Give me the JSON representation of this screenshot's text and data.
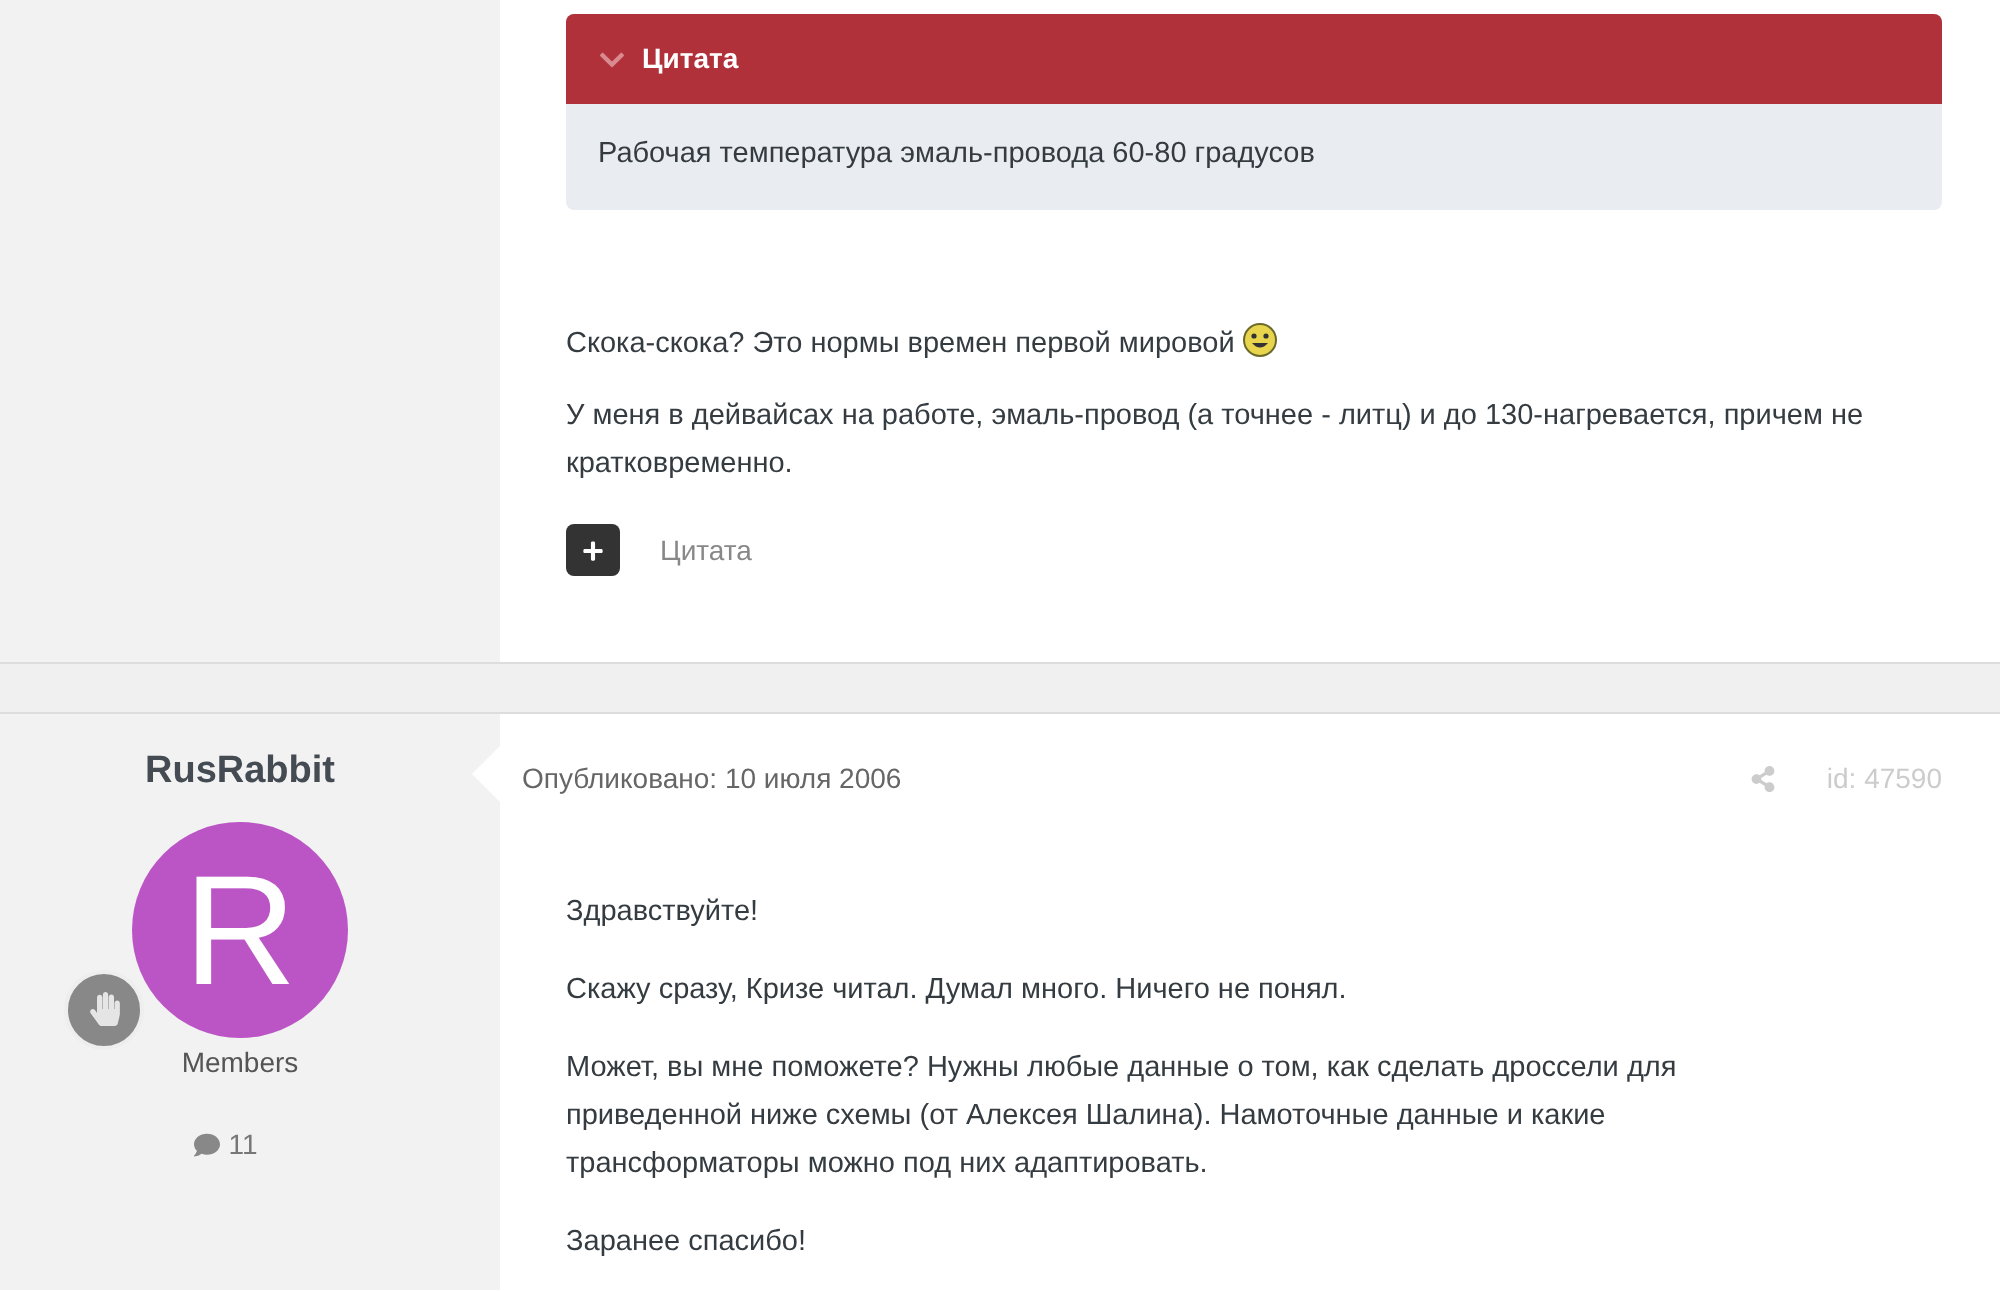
{
  "posts": [
    {
      "quote": {
        "title": "Цитата",
        "text": "Рабочая температура эмаль-провода 60-80 градусов"
      },
      "paragraphs": [
        {
          "text": "Скока-скока? Это нормы времен первой мировой",
          "emoji": true
        },
        {
          "text": "У меня в дейвайсах на работе, эмаль-провод (а точнее - литц) и до 130-нагревается, причем не кратковременно.",
          "emoji": false
        }
      ],
      "quote_button": "Цитата"
    },
    {
      "author": {
        "name": "RusRabbit",
        "initial": "R",
        "group": "Members",
        "posts": "11"
      },
      "published": "Опубликовано: 10 июля 2006",
      "id": "id: 47590",
      "paragraphs": [
        {
          "text": "Здравствуйте!",
          "emoji": false
        },
        {
          "text": "Скажу сразу, Кризе читал. Думал много. Ничего не понял.",
          "emoji": false
        },
        {
          "text": "Может, вы мне поможете? Нужны любые данные о том, как сделать дроссели для приведенной ниже схемы (от Алексея Шалина). Намоточные данные и какие трансформаторы можно под них адаптировать.",
          "emoji": false
        },
        {
          "text": "Заранее спасибо!",
          "emoji": false
        }
      ]
    }
  ]
}
